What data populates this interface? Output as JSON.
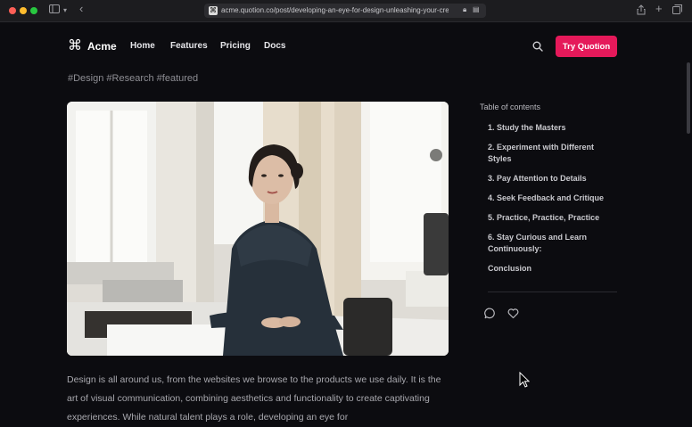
{
  "browser": {
    "url": "acme.quotion.co/post/developing-an-eye-for-design-unleashing-your-creative-"
  },
  "nav": {
    "brand": "Acme",
    "links": [
      "Home",
      "Features",
      "Pricing",
      "Docs"
    ],
    "cta": "Try Quotion"
  },
  "post": {
    "tags": "#Design #Research #featured",
    "image_alt": "Woman sitting at a desk by a window",
    "body": "Design is all around us, from the websites we browse to the products we use daily. It is the art of visual communication, combining aesthetics and functionality to create captivating experiences. While natural talent plays a role, developing an eye for"
  },
  "toc": {
    "title": "Table of contents",
    "items": [
      "1. Study the Masters",
      "2. Experiment with Different Styles",
      "3. Pay Attention to Details",
      "4. Seek Feedback and Critique",
      "5. Practice, Practice, Practice",
      "6. Stay Curious and Learn Continuously:",
      "Conclusion"
    ]
  },
  "icons": {
    "search": "search-icon",
    "comment": "comment-icon",
    "like": "heart-icon"
  },
  "colors": {
    "background": "#0c0c10",
    "accent": "#e5195a"
  }
}
